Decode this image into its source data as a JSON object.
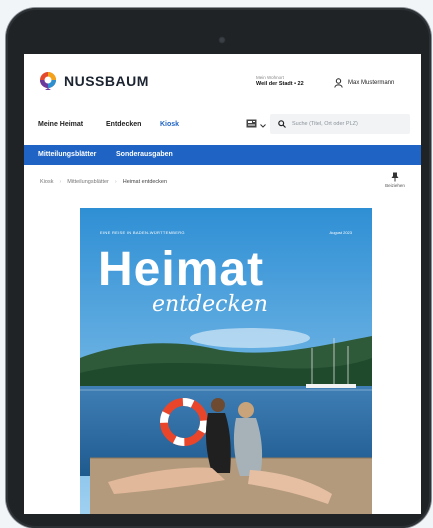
{
  "brand": {
    "name": "NUSSBAUM"
  },
  "header": {
    "location_caption": "Mein Wohnort",
    "location_value": "Weil der Stadt • 22",
    "user_name": "Max Mustermann"
  },
  "nav": {
    "items": [
      "Meine Heimat",
      "Entdecken",
      "Kiosk"
    ],
    "active": "Kiosk"
  },
  "search": {
    "placeholder": "Suche (Titel, Ort oder PLZ)"
  },
  "subnav": {
    "items": [
      "Mitteilungsblätter",
      "Sonderausgaben"
    ]
  },
  "breadcrumb": {
    "items": [
      "Kiosk",
      "Mitteilungsblätter",
      "Heimat entdecken"
    ]
  },
  "bookmark": {
    "label": "Beiziehen"
  },
  "cover": {
    "kicker": "EINE REISE IN BADEN-WÜRTTEMBERG",
    "issue": "August 2023",
    "title": "Heimat",
    "subtitle": "entdecken"
  },
  "colors": {
    "accent": "#1f64c4",
    "tablet": "#1f2326"
  }
}
